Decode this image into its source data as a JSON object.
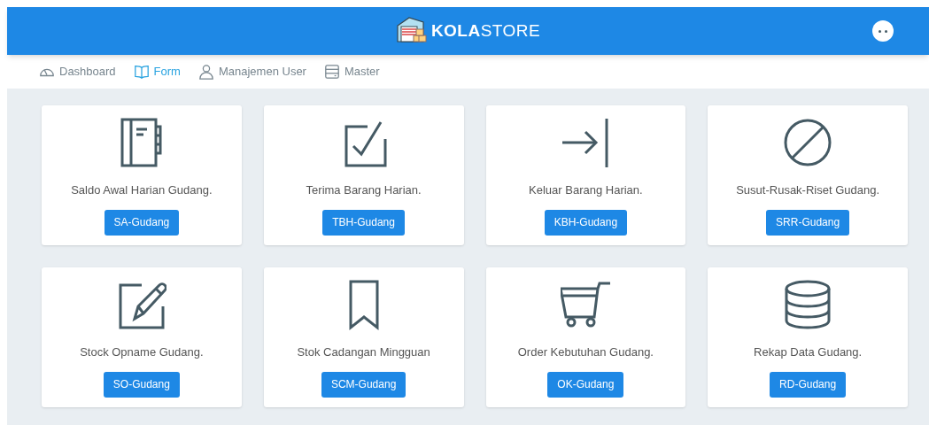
{
  "header": {
    "brand_strong": "KOLA",
    "brand_light": "STORE"
  },
  "nav": [
    {
      "label": "Dashboard",
      "kind": "gauge",
      "selected": false
    },
    {
      "label": "Form",
      "kind": "book",
      "selected": true
    },
    {
      "label": "Manajemen User",
      "kind": "user",
      "selected": false
    },
    {
      "label": "Master",
      "kind": "server",
      "selected": false
    }
  ],
  "cards": [
    {
      "kind": "notebook",
      "title": "Saldo Awal Harian Gudang.",
      "button": "SA-Gudang"
    },
    {
      "kind": "checkbox",
      "title": "Terima Barang Harian.",
      "button": "TBH-Gudang"
    },
    {
      "kind": "arrow",
      "title": "Keluar Barang Harian.",
      "button": "KBH-Gudang"
    },
    {
      "kind": "ban",
      "title": "Susut-Rusak-Riset Gudang.",
      "button": "SRR-Gudang"
    },
    {
      "kind": "edit",
      "title": "Stock Opname Gudang.",
      "button": "SO-Gudang"
    },
    {
      "kind": "bookmark",
      "title": "Stok Cadangan Mingguan",
      "button": "SCM-Gudang"
    },
    {
      "kind": "cart",
      "title": "Order Kebutuhan Gudang.",
      "button": "OK-Gudang"
    },
    {
      "kind": "database",
      "title": "Rekap Data Gudang.",
      "button": "RD-Gudang"
    }
  ]
}
